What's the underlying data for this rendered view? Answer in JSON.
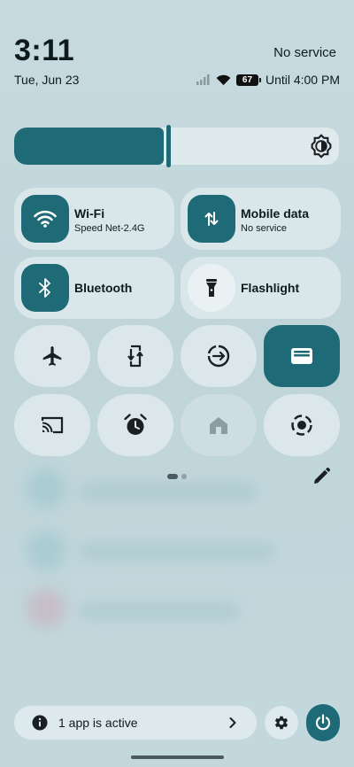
{
  "header": {
    "time": "3:11",
    "date": "Tue, Jun 23",
    "carrier": "No service",
    "battery_level": "67",
    "battery_status": "Until 4:00 PM"
  },
  "brightness": {
    "level": 0.46,
    "icon": "brightness-auto-icon"
  },
  "tiles": {
    "wifi": {
      "label": "Wi-Fi",
      "sublabel": "Speed Net-2.4G",
      "icon": "wifi-icon",
      "active": true
    },
    "mobile_data": {
      "label": "Mobile data",
      "sublabel": "No service",
      "icon": "mobile-data-icon",
      "active": true
    },
    "bluetooth": {
      "label": "Bluetooth",
      "icon": "bluetooth-icon",
      "active": true
    },
    "flashlight": {
      "label": "Flashlight",
      "icon": "flashlight-icon",
      "active": false
    }
  },
  "small_tiles": [
    {
      "name": "airplane-mode",
      "icon": "airplane-icon",
      "active": false
    },
    {
      "name": "auto-rotate",
      "icon": "rotate-icon",
      "active": false
    },
    {
      "name": "data-saver",
      "icon": "data-saver-icon",
      "active": false
    },
    {
      "name": "wallet",
      "icon": "wallet-icon",
      "active": true
    },
    {
      "name": "screen-cast",
      "icon": "cast-icon",
      "active": false
    },
    {
      "name": "alarm",
      "icon": "alarm-icon",
      "active": false
    },
    {
      "name": "home-controls",
      "icon": "home-icon",
      "active": false,
      "disabled": true
    },
    {
      "name": "screen-record",
      "icon": "screen-record-icon",
      "active": false
    }
  ],
  "pager": {
    "current": 1,
    "total": 2
  },
  "footer": {
    "active_apps_label": "1 app is active",
    "settings_icon": "gear-icon",
    "power_icon": "power-icon"
  },
  "colors": {
    "accent": "#1e6a76",
    "tile_bg": "#dae7ea",
    "background": "#c2d6db"
  }
}
